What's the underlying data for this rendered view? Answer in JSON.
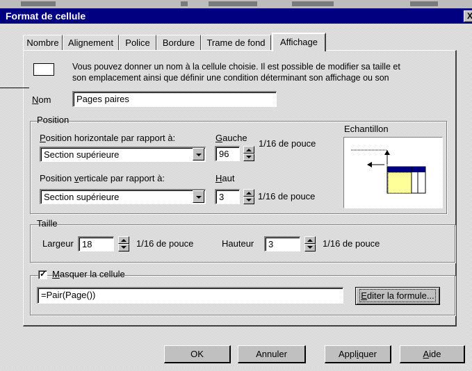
{
  "dialog": {
    "title": "Format de cellule",
    "close_glyph": "X"
  },
  "tabs": [
    {
      "label": "Nombre"
    },
    {
      "label": "Alignement"
    },
    {
      "label": "Police"
    },
    {
      "label": "Bordure"
    },
    {
      "label": "Trame de fond"
    },
    {
      "label": "Affichage",
      "active": true
    }
  ],
  "intro": {
    "line1": "Vous pouvez donner un nom à la cellule choisie. Il est possible de modifier sa taille et",
    "line2": "son emplacement ainsi que définir une condition déterminant son affichage ou son"
  },
  "name_field": {
    "label_first": "N",
    "label_rest": "om",
    "value": "Pages paires"
  },
  "position": {
    "legend": "Position",
    "horizontal_label_first": "P",
    "horizontal_label_rest": "osition horizontale par rapport à:",
    "horizontal_value": "Section supérieure",
    "left_label_first": "G",
    "left_label_rest": "auche",
    "left_value": "96",
    "unit": "1/16 de pouce",
    "vertical_label_a": "Position ",
    "vertical_label_u": "v",
    "vertical_label_b": "erticale par rapport à:",
    "vertical_value": "Section supérieure",
    "top_label_first": "H",
    "top_label_rest": "aut",
    "top_value": "3"
  },
  "sample": {
    "label": "Echantillon"
  },
  "size": {
    "legend": "Taille",
    "width_label": "Largeur",
    "width_value": "18",
    "height_label": "Hauteur",
    "height_value": "3",
    "unit": "1/16 de pouce"
  },
  "hide": {
    "checkbox_checked": true,
    "label_first": "M",
    "label_rest": "asquer la cellule",
    "formula": "=Pair(Page())",
    "edit_label_first": "E",
    "edit_label_rest": "diter la formule..."
  },
  "buttons": {
    "ok": "OK",
    "cancel": "Annuler",
    "apply_a": "Appl",
    "apply_u": "i",
    "apply_b": "quer",
    "help_u": "A",
    "help_rest": "ide"
  },
  "colors": {
    "titlebar": "#000080",
    "face": "#c0c0c0",
    "sample_fill": "#ffff99",
    "sample_header": "#000080"
  }
}
